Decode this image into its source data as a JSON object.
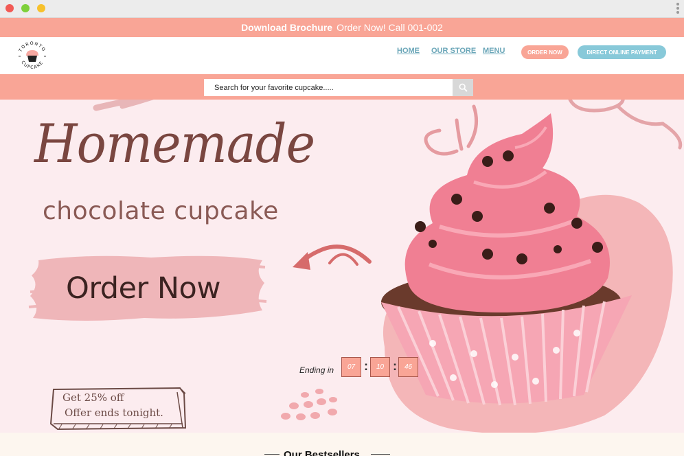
{
  "window": {
    "controls": [
      "close",
      "minimize",
      "maximize"
    ]
  },
  "promo": {
    "brochure": "Download Brochure",
    "call": "Order Now! Call 001-002"
  },
  "logo": {
    "text_top": "TORONTO",
    "text_bottom": "CUPCAKE",
    "icon": "cupcake-icon"
  },
  "nav": {
    "home": "HOME",
    "store": "OUR STORE",
    "menu": "MENU",
    "order_now": "ORDER NOW",
    "payment": "DIRECT ONLINE PAYMENT"
  },
  "search": {
    "placeholder": "Search for your favorite cupcake.....",
    "icon": "search-icon"
  },
  "hero": {
    "headline": "Homemade",
    "subheadline": "chocolate cupcake",
    "cta": "Order Now",
    "ending_label": "Ending in",
    "countdown": {
      "hours": "07",
      "minutes": "10",
      "seconds": "46"
    },
    "offer_line1": "Get 25% off",
    "offer_line2": "Offer ends tonight."
  },
  "bestsellers": {
    "title": "Our Bestsellers"
  },
  "colors": {
    "accent": "#f9a596",
    "teal": "#88c9d9",
    "hero_bg": "#fcecef",
    "brown": "#7a4640"
  }
}
